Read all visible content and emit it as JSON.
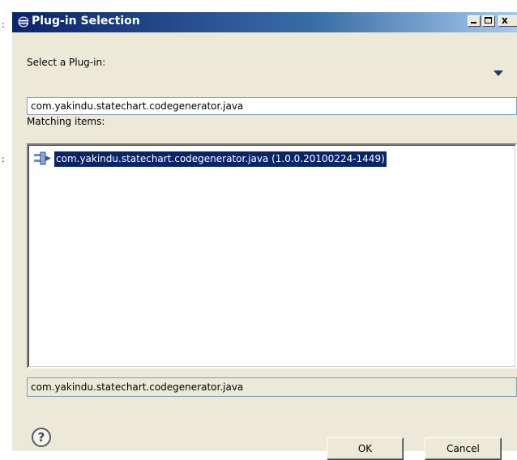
{
  "window": {
    "title": "Plug-in Selection",
    "accent": "#0a246a",
    "controls": {
      "minimize": "_",
      "maximize": "□",
      "close": "x"
    }
  },
  "selector": {
    "label": "Select a Plug-in:",
    "menu_icon": "dropdown-arrow-icon"
  },
  "filter": {
    "value": "com.yakindu.statechart.codegenerator.java"
  },
  "matching": {
    "label": "Matching items:",
    "items": [
      {
        "icon": "plugin-icon",
        "label": "com.yakindu.statechart.codegenerator.java (1.0.0.20100224-1449)",
        "selected": true
      }
    ]
  },
  "status": {
    "text": "com.yakindu.statechart.codegenerator.java"
  },
  "buttons": {
    "help_icon": "help-icon",
    "ok": "OK",
    "cancel": "Cancel"
  },
  "background_marks": [
    ":",
    ":"
  ]
}
